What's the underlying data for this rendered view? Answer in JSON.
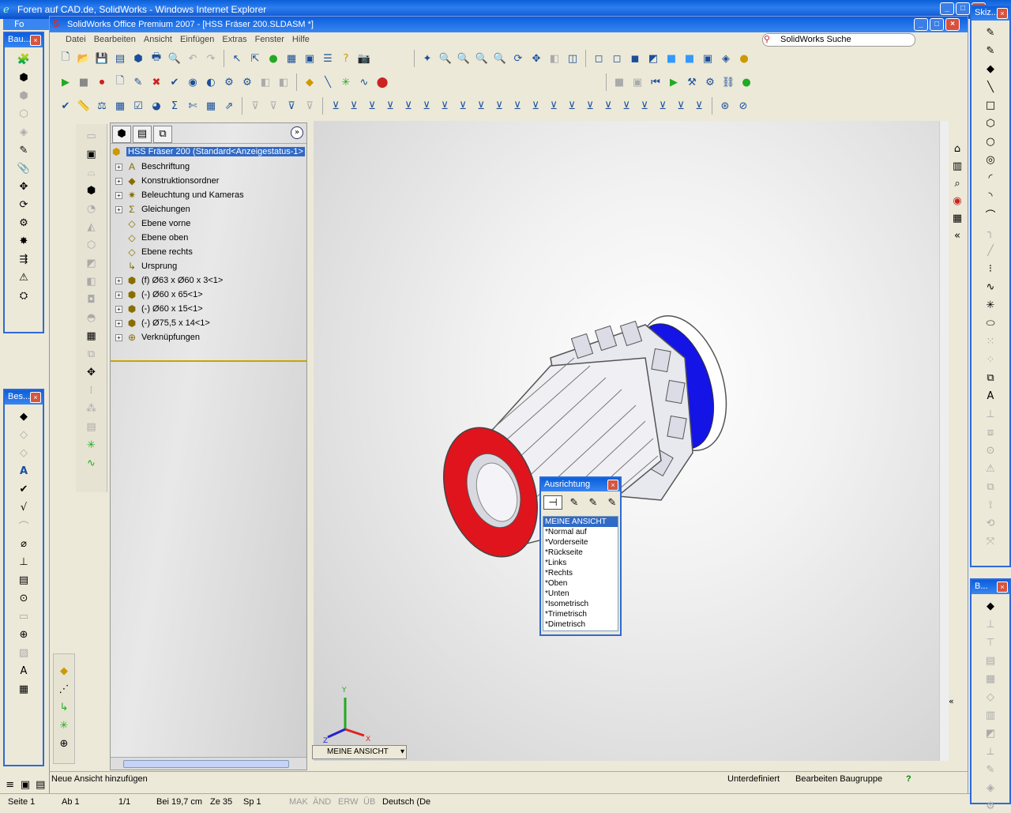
{
  "ie": {
    "title": "Foren auf CAD.de, SolidWorks - Windows Internet Explorer",
    "tab": "Fo"
  },
  "panels": {
    "bau": "Bau...",
    "bes": "Bes...",
    "skiz": "Skiz...",
    "b": "B..."
  },
  "sw": {
    "title": "SolidWorks Office Premium 2007 - [HSS Fräser 200.SLDASM *]",
    "menu": [
      "Datei",
      "Bearbeiten",
      "Ansicht",
      "Einfügen",
      "Extras",
      "Fenster",
      "Hilfe"
    ],
    "search": "SolidWorks Suche"
  },
  "tree": {
    "root": "HSS Fräser 200  (Standard<Anzeigestatus-1>",
    "items": [
      {
        "label": "Beschriftung",
        "icon": "A",
        "exp": true
      },
      {
        "label": "Konstruktionsordner",
        "icon": "◆",
        "exp": true
      },
      {
        "label": "Beleuchtung und Kameras",
        "icon": "✷",
        "exp": true
      },
      {
        "label": "Gleichungen",
        "icon": "Σ",
        "exp": true
      },
      {
        "label": "Ebene vorne",
        "icon": "◇",
        "exp": false
      },
      {
        "label": "Ebene oben",
        "icon": "◇",
        "exp": false
      },
      {
        "label": "Ebene rechts",
        "icon": "◇",
        "exp": false
      },
      {
        "label": "Ursprung",
        "icon": "↳",
        "exp": false
      },
      {
        "label": "(f) Ø63 x Ø60 x 3<1>",
        "icon": "⬢",
        "exp": true
      },
      {
        "label": "(-) Ø60 x 65<1>",
        "icon": "⬢",
        "exp": true
      },
      {
        "label": "(-) Ø60 x 15<1>",
        "icon": "⬢",
        "exp": true
      },
      {
        "label": "(-) Ø75,5 x 14<1>",
        "icon": "⬢",
        "exp": true
      },
      {
        "label": "Verknüpfungen",
        "icon": "⊕",
        "exp": true
      }
    ]
  },
  "orientation": {
    "title": "Ausrichtung",
    "items": [
      "MEINE ANSICHT",
      "*Normal auf",
      "*Vorderseite",
      "*Rückseite",
      "*Links",
      "*Rechts",
      "*Oben",
      "*Unten",
      "*Isometrisch",
      "*Trimetrisch",
      "*Dimetrisch"
    ]
  },
  "viewname": "MEINE ANSICHT",
  "axes": {
    "x": "X",
    "y": "Y",
    "z": "Z"
  },
  "status": {
    "left": "Neue Ansicht hinzufügen",
    "state": "Unterdefiniert",
    "mode": "Bearbeiten Baugruppe",
    "help": "?"
  },
  "iestatus": {
    "seite": "Seite 1",
    "ab": "Ab 1",
    "pages": "1/1",
    "bei": "Bei 19,7 cm",
    "ze": "Ze 35",
    "sp": "Sp 1",
    "mak": "MAK",
    "aend": "ÄND",
    "erw": "ERW",
    "ueb": "ÜB",
    "lang": "Deutsch (De"
  },
  "colors": {
    "accent": "#316ac5",
    "red": "#e0141c",
    "blue": "#1414e6",
    "body": "#ffffff"
  }
}
